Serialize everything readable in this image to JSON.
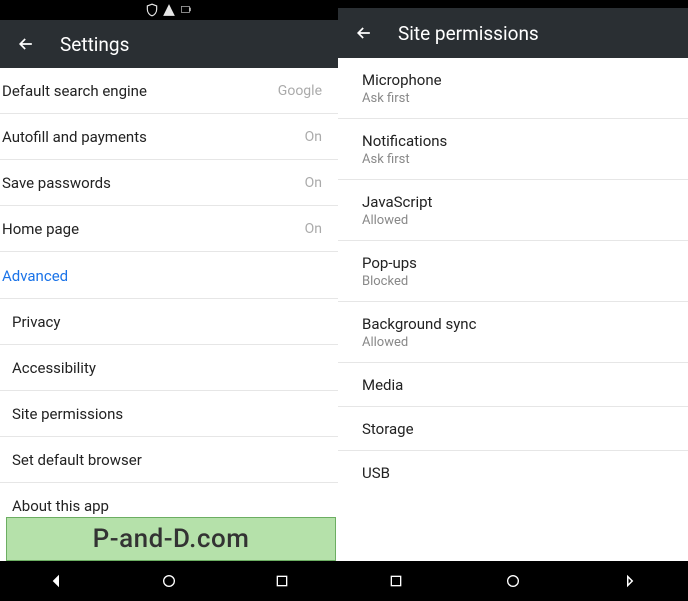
{
  "left": {
    "title": "Settings",
    "items": [
      {
        "label": "Default search engine",
        "value": "Google"
      },
      {
        "label": "Autofill and payments",
        "value": "On"
      },
      {
        "label": "Save passwords",
        "value": "On"
      },
      {
        "label": "Home page",
        "value": "On"
      }
    ],
    "section": "Advanced",
    "advanced": [
      {
        "label": "Privacy"
      },
      {
        "label": "Accessibility"
      },
      {
        "label": "Site permissions"
      },
      {
        "label": "Set default browser"
      },
      {
        "label": "About this app"
      }
    ]
  },
  "right": {
    "title": "Site permissions",
    "items": [
      {
        "label": "Microphone",
        "sub": "Ask first"
      },
      {
        "label": "Notifications",
        "sub": "Ask first"
      },
      {
        "label": "JavaScript",
        "sub": "Allowed"
      },
      {
        "label": "Pop-ups",
        "sub": "Blocked"
      },
      {
        "label": "Background sync",
        "sub": "Allowed"
      },
      {
        "label": "Media",
        "sub": ""
      },
      {
        "label": "Storage",
        "sub": ""
      },
      {
        "label": "USB",
        "sub": ""
      }
    ]
  },
  "watermark": "P-and-D.com"
}
